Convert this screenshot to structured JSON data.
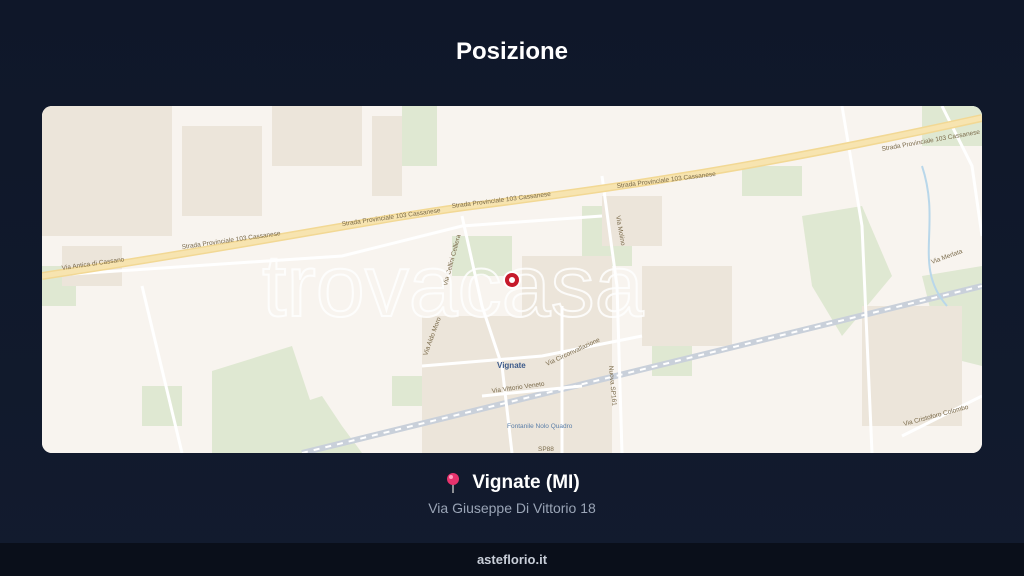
{
  "header": {
    "title": "Posizione"
  },
  "map": {
    "watermark": "trovacasa",
    "labels": {
      "road_main_1": "Strada Provinciale 103 Cassanese",
      "road_main_2": "Strada Provinciale 103 Cassanese",
      "road_main_3": "Strada Provinciale 103 Cassanese",
      "road_main_4": "Strada Provinciale 103 Cassanese",
      "road_main_5": "Strada Provinciale 103 Cassanese",
      "road_antica": "Via Antica di Cassano",
      "road_molino": "Via Molino",
      "road_celliera": "Via Cellini Celliera",
      "road_aldo_moro": "Via Aldo Moro",
      "road_circonvallazione": "Via Circonvallazione",
      "road_vittorio_veneto": "Via Vittorio Veneto",
      "road_nuova": "Nuova SP161",
      "road_colombo": "Via Cristoforo Colombo",
      "road_merlata": "Via Merlata",
      "place_vignate": "Vignate",
      "place_fontanile": "Fontanile Nolo Quadro",
      "road_sp": "SP88"
    }
  },
  "location": {
    "city": "Vignate (MI)",
    "address": "Via Giuseppe Di Vittorio 18",
    "pin_color": "#e8336d"
  },
  "footer": {
    "site": "asteflorio.it"
  }
}
